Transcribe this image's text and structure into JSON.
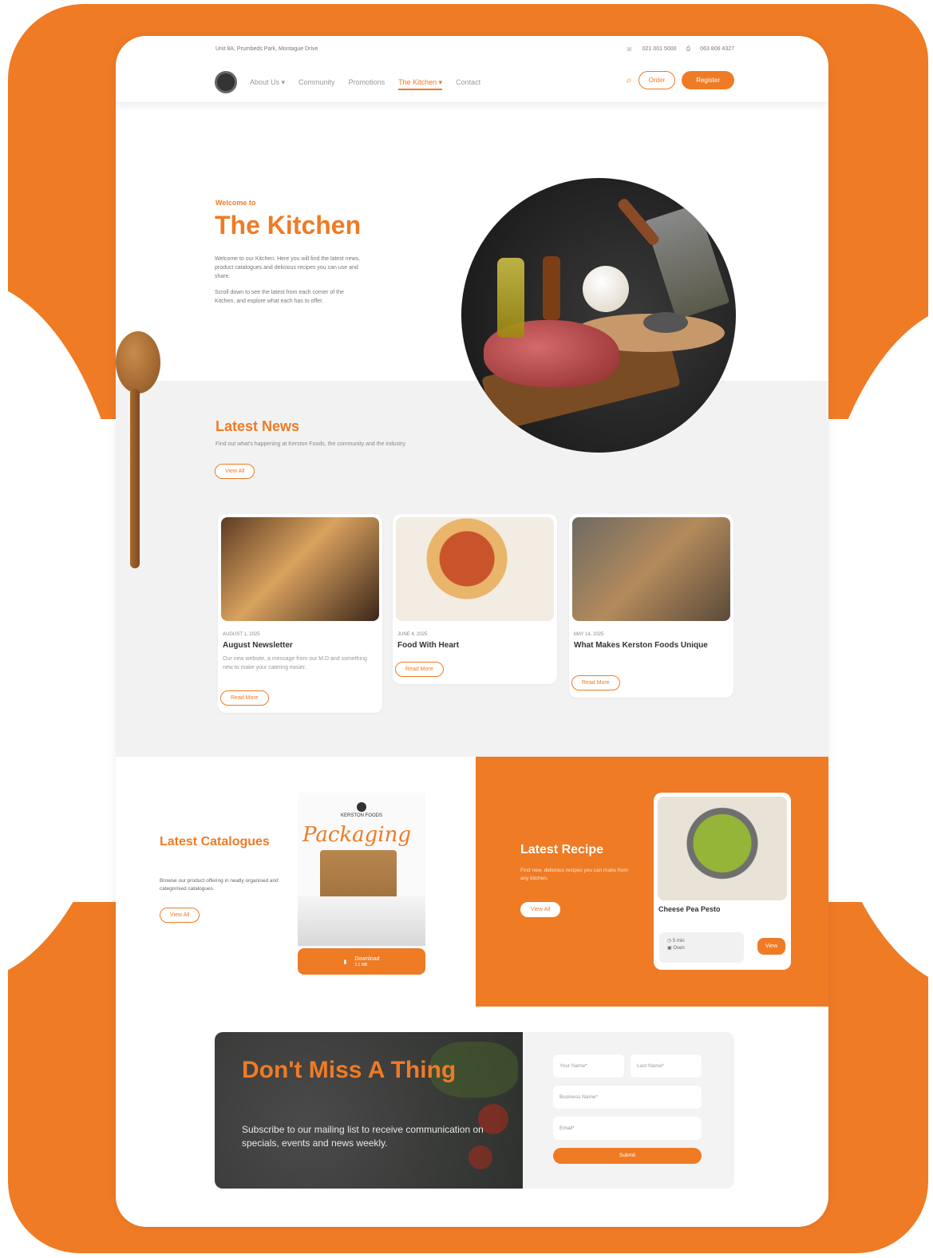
{
  "colors": {
    "accent": "#ef7b25",
    "background": "#ffffff",
    "section_gray": "#f2f2f2"
  },
  "topbar": {
    "address": "Unit 8A, Prumbeds Park, Montague Drive",
    "phone": "021 001 5000",
    "fax": "063 806 4327"
  },
  "nav": {
    "items": [
      {
        "label": "About Us ▾",
        "active": false
      },
      {
        "label": "Community",
        "active": false
      },
      {
        "label": "Promotions",
        "active": false
      },
      {
        "label": "The Kitchen ▾",
        "active": true
      },
      {
        "label": "Contact",
        "active": false
      }
    ],
    "order_label": "Order",
    "register_label": "Register",
    "icons": {
      "search": "search-icon",
      "phone": "phone-icon",
      "fax": "fax-icon",
      "logo": "kerston-logo"
    }
  },
  "hero": {
    "welcome": "Welcome to",
    "title": "The Kitchen",
    "p1": "Welcome to our Kitchen. Here you will find the latest news, product catalogues and delicious recipes you can use and share.",
    "p2": "Scroll down to see the latest from each corner of the Kitchen, and explore what each has to offer."
  },
  "news": {
    "title": "Latest News",
    "subtitle": "Find out what's happening at Kerston Foods, the community and the industry.",
    "view_all": "View All",
    "cards": [
      {
        "date": "AUGUST 1, 2025",
        "title": "August Newsletter",
        "desc": "Our new website, a message from our M.D and something new to make your catering easier.",
        "cta": "Read More"
      },
      {
        "date": "JUNE 4, 2025",
        "title": "Food With Heart",
        "desc": "",
        "cta": "Read More"
      },
      {
        "date": "MAY 14, 2025",
        "title": "What Makes Kerston Foods Unique",
        "desc": "",
        "cta": "Read More"
      }
    ]
  },
  "catalogues": {
    "title": "Latest Catalogues",
    "desc": "Browse our product offering in neatly organised and categorised catalogues.",
    "view_all": "View All",
    "brand": "KERSTON FOODS",
    "script_title": "Packaging",
    "download": "Download",
    "download_size": "2.1 MB"
  },
  "recipe": {
    "title": "Latest Recipe",
    "desc": "Find new, delicious recipes you can make from any kitchen.",
    "view_all": "View All",
    "card_name": "Cheese Pea Pesto",
    "meta_time": "5 min",
    "meta_method": "Oven",
    "view": "View"
  },
  "newsletter": {
    "title": "Don't Miss A Thing",
    "text": "Subscribe to our mailing list to receive communication on specials, events and news weekly.",
    "placeholders": {
      "first": "Your Name*",
      "last": "Last Name*",
      "business": "Business Name*",
      "email": "Email*"
    },
    "submit": "Submit"
  }
}
